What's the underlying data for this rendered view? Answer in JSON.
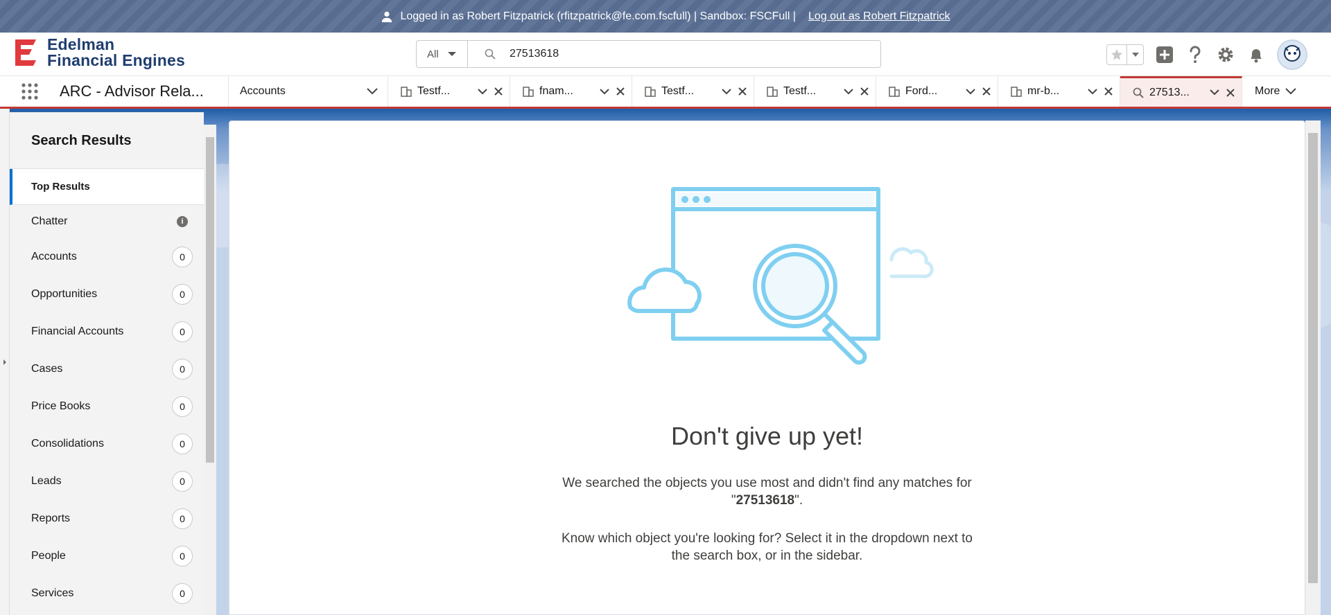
{
  "banner": {
    "text": "Logged in as Robert Fitzpatrick (rfitzpatrick@fe.com.fscfull) | Sandbox: FSCFull |",
    "logout_link": "Log out as Robert Fitzpatrick"
  },
  "header": {
    "logo_line1": "Edelman",
    "logo_line2": "Financial Engines",
    "search_scope": "All",
    "search_value": "27513618"
  },
  "nav": {
    "app_name": "ARC - Advisor Rela...",
    "accounts_label": "Accounts",
    "tabs": [
      {
        "label": "Testf...",
        "icon": "account-icon"
      },
      {
        "label": "fnam...",
        "icon": "account-icon"
      },
      {
        "label": "Testf...",
        "icon": "account-icon"
      },
      {
        "label": "Testf...",
        "icon": "account-icon"
      },
      {
        "label": "Ford...",
        "icon": "account-icon"
      },
      {
        "label": "mr-b...",
        "icon": "account-icon"
      },
      {
        "label": "27513...",
        "icon": "search-icon",
        "active": true
      }
    ],
    "more_label": "More"
  },
  "sidebar": {
    "title": "Search Results",
    "items": [
      {
        "label": "Top Results"
      },
      {
        "label": "Chatter",
        "info": "i"
      },
      {
        "label": "Accounts",
        "count": "0"
      },
      {
        "label": "Opportunities",
        "count": "0"
      },
      {
        "label": "Financial Accounts",
        "count": "0"
      },
      {
        "label": "Cases",
        "count": "0"
      },
      {
        "label": "Price Books",
        "count": "0"
      },
      {
        "label": "Consolidations",
        "count": "0"
      },
      {
        "label": "Leads",
        "count": "0"
      },
      {
        "label": "Reports",
        "count": "0"
      },
      {
        "label": "People",
        "count": "0"
      },
      {
        "label": "Services",
        "count": "0"
      }
    ]
  },
  "main": {
    "title": "Don't give up yet!",
    "msg1_prefix": "We searched the objects you use most and didn't find any matches for",
    "msg1_open_quote": "\"",
    "msg1_term": "27513618",
    "msg1_close": "\".",
    "msg2_line1": "Know which object you're looking for? Select it in the dropdown next to",
    "msg2_line2": "the search box, or in the sidebar."
  },
  "colors": {
    "brand_red": "#c23934",
    "accent_blue": "#0070d2",
    "illustration_blue": "#7fcff0"
  }
}
